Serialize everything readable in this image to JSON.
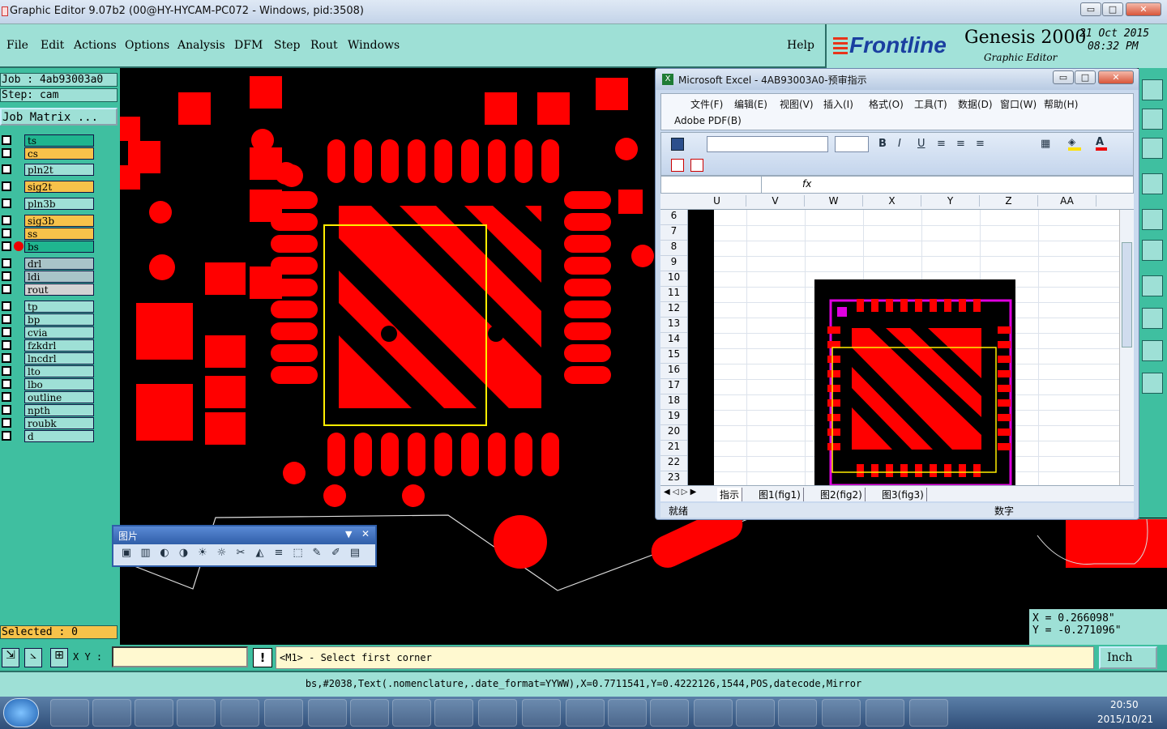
{
  "window": {
    "title": "Graphic Editor 9.07b2 (00@HY-HYCAM-PC072 - Windows, pid:3508)",
    "min": "▭",
    "max": "□",
    "close": "✕"
  },
  "menu": [
    "File",
    "Edit",
    "Actions",
    "Options",
    "Analysis",
    "DFM",
    "Step",
    "Rout",
    "Windows"
  ],
  "help": "Help",
  "brand": {
    "logo": "Frontline",
    "product": "Genesis 2000",
    "subtitle": "Graphic Editor",
    "date": "21 Oct 2015",
    "time": "08:32 PM"
  },
  "job": {
    "job": "Job : 4ab93003a0",
    "step": "Step: cam",
    "matrix": "Job Matrix ..."
  },
  "layers": [
    {
      "name": "ts",
      "color": "#1fb58f"
    },
    {
      "name": "cs",
      "color": "#f7c24a"
    },
    {
      "name": "pln2t",
      "color": "#9ee0d6"
    },
    {
      "name": "sig2t",
      "color": "#f7c24a"
    },
    {
      "name": "pln3b",
      "color": "#9ee0d6"
    },
    {
      "name": "sig3b",
      "color": "#f7c24a"
    },
    {
      "name": "ss",
      "color": "#f7c24a"
    },
    {
      "name": "bs",
      "color": "#1fb58f",
      "active": true
    },
    {
      "name": "drl",
      "color": "#a9c4c8"
    },
    {
      "name": "ldi",
      "color": "#a9c4c8"
    },
    {
      "name": "rout",
      "color": "#d3d3d3"
    },
    {
      "name": "tp",
      "color": "#9ee0d6"
    },
    {
      "name": "bp",
      "color": "#9ee0d6"
    },
    {
      "name": "cvia",
      "color": "#9ee0d6"
    },
    {
      "name": "fzkdrl",
      "color": "#9ee0d6"
    },
    {
      "name": "lncdrl",
      "color": "#9ee0d6"
    },
    {
      "name": "lto",
      "color": "#9ee0d6"
    },
    {
      "name": "lbo",
      "color": "#9ee0d6"
    },
    {
      "name": "outline",
      "color": "#9ee0d6"
    },
    {
      "name": "npth",
      "color": "#9ee0d6"
    },
    {
      "name": "roubk",
      "color": "#9ee0d6"
    },
    {
      "name": "d",
      "color": "#9ee0d6"
    }
  ],
  "selected": "Selected : 0",
  "coord": {
    "x": "X = 0.266098\"",
    "y": "Y = -0.271096\""
  },
  "cmd": {
    "xy_label": "X Y :",
    "xy_value": "",
    "prompt": "<M1> - Select first corner",
    "units": "Inch"
  },
  "status": "bs,#2038,Text(.nomenclature,.date_format=YYWW),X=0.7711541,Y=0.4222126,1544,POS,datecode,Mirror",
  "excel": {
    "title": "Microsoft Excel - 4AB93003A0-预审指示",
    "menus": [
      "文件(F)",
      "编辑(E)",
      "视图(V)",
      "插入(I)",
      "格式(O)",
      "工具(T)",
      "数据(D)",
      "窗口(W)",
      "帮助(H)"
    ],
    "pdf": "Adobe PDF(B)",
    "fx": "fx",
    "columns": [
      "U",
      "V",
      "W",
      "X",
      "Y",
      "Z",
      "AA"
    ],
    "rows": [
      "6",
      "7",
      "8",
      "9",
      "10",
      "11",
      "12",
      "13",
      "14",
      "15",
      "16",
      "17",
      "18",
      "19",
      "20",
      "21",
      "22",
      "23"
    ],
    "sheets": [
      "指示",
      "图1(fig1)",
      "图2(fig2)",
      "图3(fig3)"
    ],
    "ready": "就绪",
    "num": "数字"
  },
  "picbar": {
    "title": "图片"
  },
  "tray": {
    "time": "20:50",
    "date": "2015/10/21"
  },
  "colors": {
    "pad": "#ff0000",
    "panel": "#9ee0d6",
    "frame": "#3fbfa0",
    "highlight": "#ffee00",
    "magenta": "#e000e0"
  }
}
